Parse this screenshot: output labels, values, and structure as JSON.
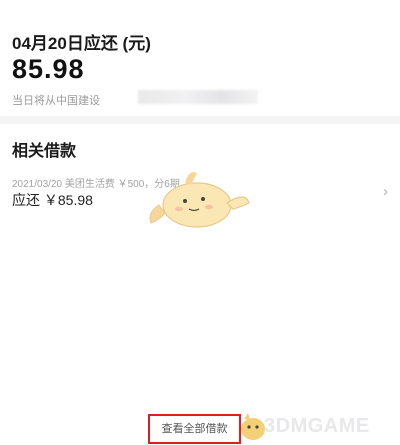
{
  "due": {
    "title": "04月20日应还 (元)",
    "amount": "85.98",
    "note": "当日将从中国建设"
  },
  "related": {
    "title": "相关借款",
    "loan": {
      "meta": "2021/03/20 美团生活费 ￥500，分6期",
      "repay": "应还 ￥85.98",
      "chevron": "›"
    }
  },
  "footer": {
    "view_all": "查看全部借款"
  },
  "watermark": {
    "text": "3DMGAME"
  },
  "colors": {
    "highlight_box": "#e21d1d",
    "background": "#f4f4f5"
  }
}
